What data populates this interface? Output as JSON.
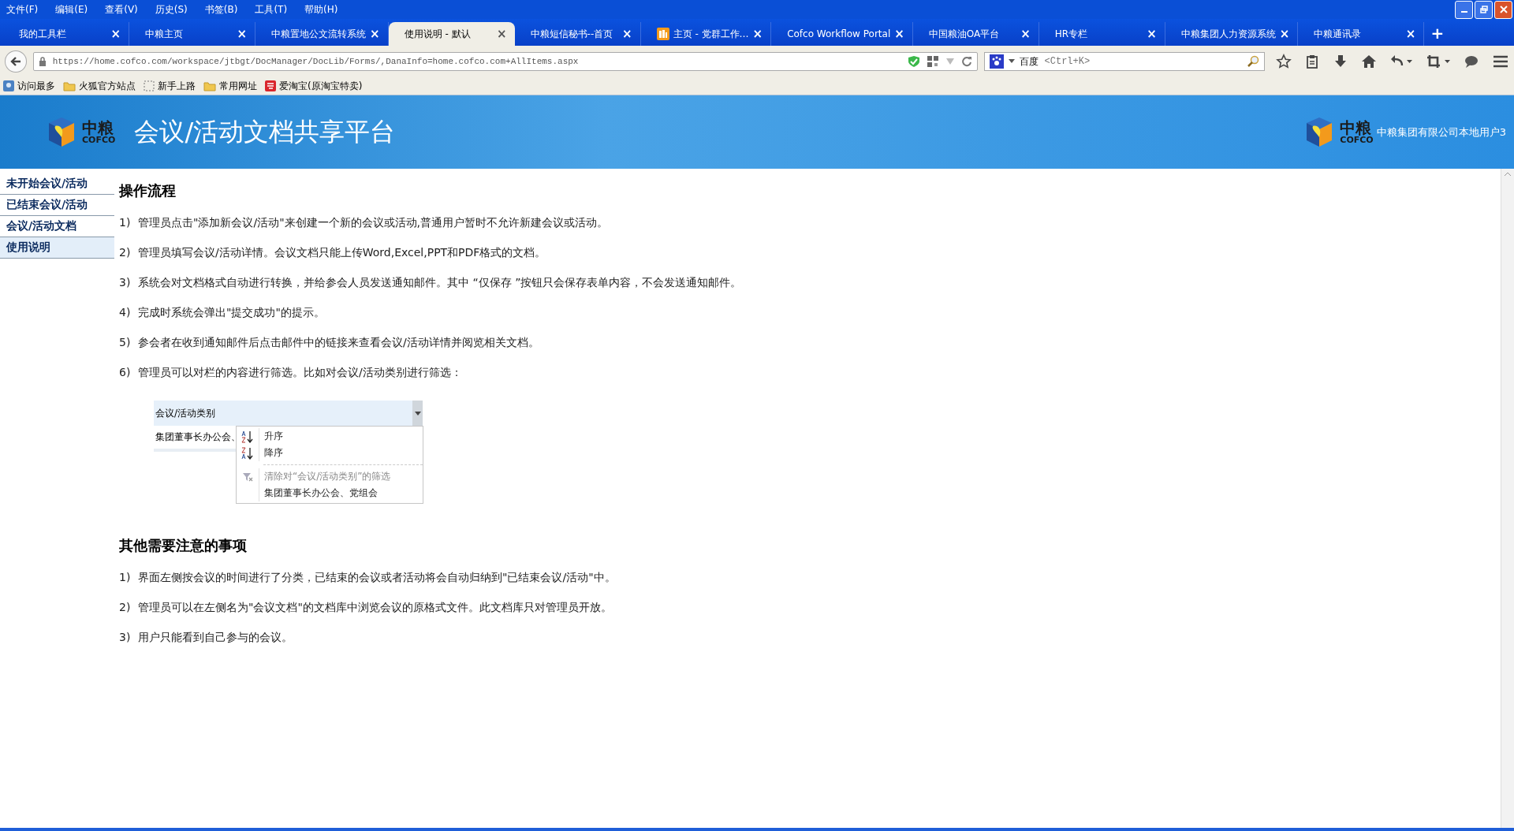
{
  "menu_bar": [
    "文件(F)",
    "编辑(E)",
    "查看(V)",
    "历史(S)",
    "书签(B)",
    "工具(T)",
    "帮助(H)"
  ],
  "tabs": [
    {
      "label": "我的工具栏",
      "selected": false,
      "kind": "plain"
    },
    {
      "label": "中粮主页",
      "selected": false,
      "kind": "plain"
    },
    {
      "label": "中粮置地公文流转系统",
      "selected": false,
      "kind": "plain"
    },
    {
      "label": "使用说明 - 默认",
      "selected": true,
      "kind": "plain"
    },
    {
      "label": "中粮短信秘书--首页",
      "selected": false,
      "kind": "plain"
    },
    {
      "label": "主页 - 党群工作…",
      "selected": false,
      "kind": "favicon"
    },
    {
      "label": "Cofco Workflow Portal",
      "selected": false,
      "kind": "plain"
    },
    {
      "label": "中国粮油OA平台",
      "selected": false,
      "kind": "plain"
    },
    {
      "label": "HR专栏",
      "selected": false,
      "kind": "plain"
    },
    {
      "label": "中粮集团人力资源系统",
      "selected": false,
      "kind": "plain"
    },
    {
      "label": "中粮通讯录",
      "selected": false,
      "kind": "plain"
    }
  ],
  "tab_close": "×",
  "new_tab": "+",
  "address_bar": {
    "value": "https://home.cofco.com/workspace/jtbgt/DocManager/DocLib/Forms/,DanaInfo=home.cofco.com+AllItems.aspx"
  },
  "search_box": {
    "engine": "百度",
    "placeholder": "<Ctrl+K>"
  },
  "bookmarks": [
    {
      "label": "访问最多",
      "kind": "smart"
    },
    {
      "label": "火狐官方站点",
      "kind": "folder"
    },
    {
      "label": "新手上路",
      "kind": "page"
    },
    {
      "label": "常用网址",
      "kind": "folder"
    },
    {
      "label": "爱淘宝(原淘宝特卖)",
      "kind": "taobao"
    }
  ],
  "header": {
    "logo_left": {
      "cn": "中粮",
      "en": "COFCO"
    },
    "title": "会议/活动文档共享平台",
    "logo_right": {
      "cn": "中粮",
      "en": "COFCO"
    },
    "user": "中粮集团有限公司本地用户3"
  },
  "sidebar": [
    {
      "label": "未开始会议/活动",
      "selected": false
    },
    {
      "label": "已结束会议/活动",
      "selected": false
    },
    {
      "label": "会议/活动文档",
      "selected": false
    },
    {
      "label": "使用说明",
      "selected": true
    }
  ],
  "section_1": {
    "heading": "操作流程",
    "items": [
      {
        "num": "1)",
        "text": "管理员点击\"添加新会议/活动\"来创建一个新的会议或活动,普通用户暂时不允许新建会议或活动。"
      },
      {
        "num": "2)",
        "text": "管理员填写会议/活动详情。会议文档只能上传Word,Excel,PPT和PDF格式的文档。"
      },
      {
        "num": "3)",
        "text": "系统会对文档格式自动进行转换，并给参会人员发送通知邮件。其中 “仅保存 ”按钮只会保存表单内容，不会发送通知邮件。"
      },
      {
        "num": "4)",
        "text": "完成时系统会弹出\"提交成功\"的提示。"
      },
      {
        "num": "5)",
        "text": "参会者在收到通知邮件后点击邮件中的链接来查看会议/活动详情并阅览相关文档。"
      },
      {
        "num": "6)",
        "text": "管理员可以对栏的内容进行筛选。比如对会议/活动类别进行筛选："
      }
    ]
  },
  "example": {
    "column": "会议/活动类别",
    "cell": "集团董事长办公会、",
    "menu": [
      {
        "kind": "sort-asc",
        "label": "升序",
        "disabled": false
      },
      {
        "kind": "sort-desc",
        "label": "降序",
        "disabled": false
      },
      {
        "kind": "clear-filter",
        "label": "清除对“会议/活动类别”的筛选",
        "disabled": true
      },
      {
        "kind": "value",
        "label": "集团董事长办公会、党组会",
        "disabled": false
      }
    ]
  },
  "section_2": {
    "heading": "其他需要注意的事项",
    "items": [
      {
        "num": "1)",
        "text": "界面左侧按会议的时间进行了分类，已结束的会议或者活动将会自动归纳到\"已结束会议/活动\"中。"
      },
      {
        "num": "2)",
        "text": "管理员可以在左侧名为\"会议文档\"的文档库中浏览会议的原格式文件。此文档库只对管理员开放。"
      },
      {
        "num": "3)",
        "text": "用户只能看到自己参与的会议。"
      }
    ]
  }
}
